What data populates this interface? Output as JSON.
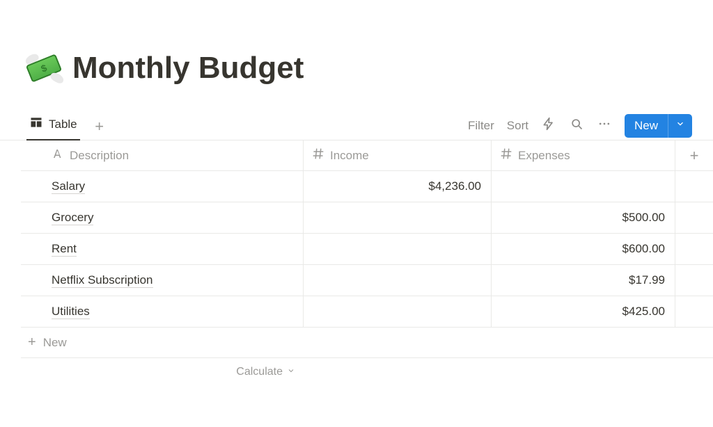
{
  "page": {
    "icon": "money-with-wings",
    "title": "Monthly Budget"
  },
  "viewbar": {
    "active_tab": {
      "label": "Table",
      "icon": "table"
    },
    "filter_label": "Filter",
    "sort_label": "Sort",
    "new_button_label": "New"
  },
  "table": {
    "columns": [
      {
        "name": "Description",
        "type": "title"
      },
      {
        "name": "Income",
        "type": "number"
      },
      {
        "name": "Expenses",
        "type": "number"
      }
    ],
    "rows": [
      {
        "description": "Salary",
        "income": "$4,236.00",
        "expenses": ""
      },
      {
        "description": "Grocery",
        "income": "",
        "expenses": "$500.00"
      },
      {
        "description": "Rent",
        "income": "",
        "expenses": "$600.00"
      },
      {
        "description": "Netflix Subscription",
        "income": "",
        "expenses": "$17.99"
      },
      {
        "description": "Utilities",
        "income": "",
        "expenses": "$425.00"
      }
    ],
    "new_row_label": "New",
    "calculate_label": "Calculate"
  }
}
